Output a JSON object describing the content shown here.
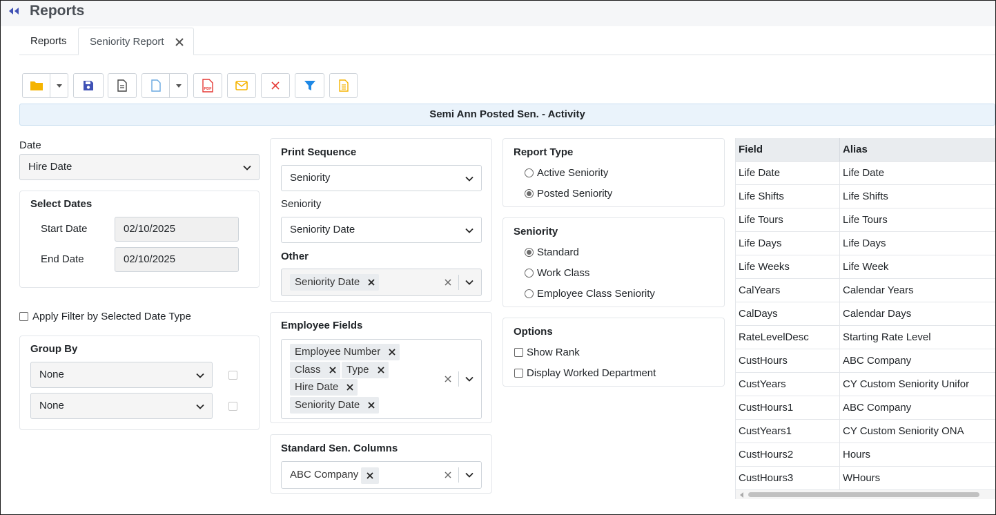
{
  "header": {
    "title": "Reports"
  },
  "tabs": [
    {
      "label": "Reports"
    },
    {
      "label": "Seniority Report"
    }
  ],
  "banner": "Semi Ann Posted Sen. - Activity",
  "left": {
    "date_label": "Date",
    "date_value": "Hire Date",
    "select_dates_title": "Select Dates",
    "start_label": "Start Date",
    "start_value": "02/10/2025",
    "end_label": "End Date",
    "end_value": "02/10/2025",
    "apply_filter_label": "Apply Filter by Selected Date Type",
    "group_by_title": "Group By",
    "group_by_1": "None",
    "group_by_2": "None"
  },
  "middle": {
    "print_sequence_title": "Print Sequence",
    "print_sequence_value": "Seniority",
    "seniority_label": "Seniority",
    "seniority_value": "Seniority Date",
    "other_title": "Other",
    "other_chips": [
      "Seniority Date"
    ],
    "employee_fields_title": "Employee Fields",
    "employee_fields_chips": [
      "Employee Number",
      "Class",
      "Type",
      "Hire Date",
      "Seniority Date"
    ],
    "standard_cols_title": "Standard Sen. Columns",
    "standard_cols_chips": [
      "ABC Company"
    ]
  },
  "right": {
    "report_type_title": "Report Type",
    "report_type_options": [
      "Active Seniority",
      "Posted Seniority"
    ],
    "report_type_selected": "Posted Seniority",
    "seniority_title": "Seniority",
    "seniority_options": [
      "Standard",
      "Work Class",
      "Employee Class Seniority"
    ],
    "seniority_selected": "Standard",
    "options_title": "Options",
    "options": [
      "Show Rank",
      "Display Worked Department"
    ]
  },
  "grid": {
    "headers": [
      "Field",
      "Alias"
    ],
    "rows": [
      [
        "Life Date",
        "Life Date"
      ],
      [
        "Life Shifts",
        "Life Shifts"
      ],
      [
        "Life Tours",
        "Life Tours"
      ],
      [
        "Life Days",
        "Life Days"
      ],
      [
        "Life Weeks",
        "Life Week"
      ],
      [
        "CalYears",
        "Calendar Years"
      ],
      [
        "CalDays",
        "Calendar Days"
      ],
      [
        "RateLevelDesc",
        "Starting Rate Level"
      ],
      [
        "CustHours",
        "ABC Company"
      ],
      [
        "CustYears",
        "CY Custom Seniority Unifor"
      ],
      [
        "CustHours1",
        "ABC Company"
      ],
      [
        "CustYears1",
        "CY Custom Seniority ONA"
      ],
      [
        "CustHours2",
        "Hours"
      ],
      [
        "CustHours3",
        "WHours"
      ]
    ]
  },
  "toolbar": {
    "icons": [
      "folder-open-icon",
      "save-icon",
      "document-icon",
      "new-document-icon",
      "pdf-icon",
      "email-icon",
      "delete-icon",
      "filter-icon",
      "notes-icon"
    ]
  },
  "colors": {
    "folder": "#f5b400",
    "save": "#3f51b5",
    "pdf": "#e53935",
    "email": "#f5b400",
    "delete": "#e53935",
    "filter": "#1e88e5",
    "notes": "#f5b400",
    "banner_bg": "#eaf3fb"
  }
}
